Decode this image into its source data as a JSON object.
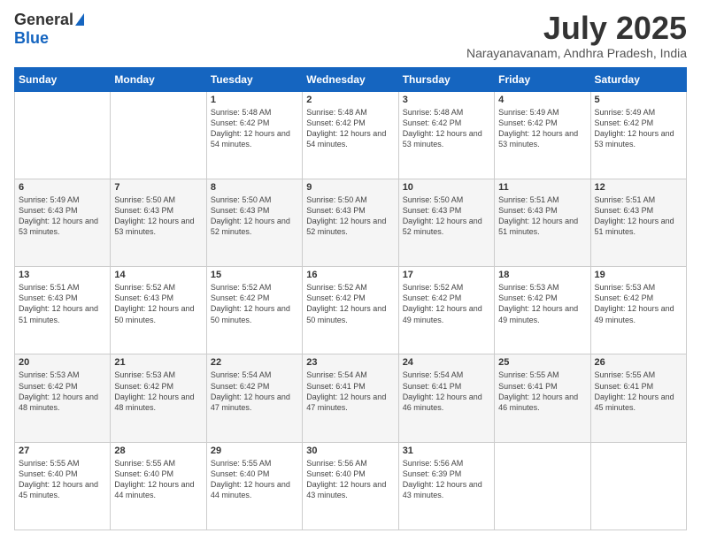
{
  "header": {
    "logo_general": "General",
    "logo_blue": "Blue",
    "title": "July 2025",
    "location": "Narayanavanam, Andhra Pradesh, India"
  },
  "days_of_week": [
    "Sunday",
    "Monday",
    "Tuesday",
    "Wednesday",
    "Thursday",
    "Friday",
    "Saturday"
  ],
  "weeks": [
    [
      {
        "day": "",
        "sunrise": "",
        "sunset": "",
        "daylight": ""
      },
      {
        "day": "",
        "sunrise": "",
        "sunset": "",
        "daylight": ""
      },
      {
        "day": "1",
        "sunrise": "Sunrise: 5:48 AM",
        "sunset": "Sunset: 6:42 PM",
        "daylight": "Daylight: 12 hours and 54 minutes."
      },
      {
        "day": "2",
        "sunrise": "Sunrise: 5:48 AM",
        "sunset": "Sunset: 6:42 PM",
        "daylight": "Daylight: 12 hours and 54 minutes."
      },
      {
        "day": "3",
        "sunrise": "Sunrise: 5:48 AM",
        "sunset": "Sunset: 6:42 PM",
        "daylight": "Daylight: 12 hours and 53 minutes."
      },
      {
        "day": "4",
        "sunrise": "Sunrise: 5:49 AM",
        "sunset": "Sunset: 6:42 PM",
        "daylight": "Daylight: 12 hours and 53 minutes."
      },
      {
        "day": "5",
        "sunrise": "Sunrise: 5:49 AM",
        "sunset": "Sunset: 6:42 PM",
        "daylight": "Daylight: 12 hours and 53 minutes."
      }
    ],
    [
      {
        "day": "6",
        "sunrise": "Sunrise: 5:49 AM",
        "sunset": "Sunset: 6:43 PM",
        "daylight": "Daylight: 12 hours and 53 minutes."
      },
      {
        "day": "7",
        "sunrise": "Sunrise: 5:50 AM",
        "sunset": "Sunset: 6:43 PM",
        "daylight": "Daylight: 12 hours and 53 minutes."
      },
      {
        "day": "8",
        "sunrise": "Sunrise: 5:50 AM",
        "sunset": "Sunset: 6:43 PM",
        "daylight": "Daylight: 12 hours and 52 minutes."
      },
      {
        "day": "9",
        "sunrise": "Sunrise: 5:50 AM",
        "sunset": "Sunset: 6:43 PM",
        "daylight": "Daylight: 12 hours and 52 minutes."
      },
      {
        "day": "10",
        "sunrise": "Sunrise: 5:50 AM",
        "sunset": "Sunset: 6:43 PM",
        "daylight": "Daylight: 12 hours and 52 minutes."
      },
      {
        "day": "11",
        "sunrise": "Sunrise: 5:51 AM",
        "sunset": "Sunset: 6:43 PM",
        "daylight": "Daylight: 12 hours and 51 minutes."
      },
      {
        "day": "12",
        "sunrise": "Sunrise: 5:51 AM",
        "sunset": "Sunset: 6:43 PM",
        "daylight": "Daylight: 12 hours and 51 minutes."
      }
    ],
    [
      {
        "day": "13",
        "sunrise": "Sunrise: 5:51 AM",
        "sunset": "Sunset: 6:43 PM",
        "daylight": "Daylight: 12 hours and 51 minutes."
      },
      {
        "day": "14",
        "sunrise": "Sunrise: 5:52 AM",
        "sunset": "Sunset: 6:43 PM",
        "daylight": "Daylight: 12 hours and 50 minutes."
      },
      {
        "day": "15",
        "sunrise": "Sunrise: 5:52 AM",
        "sunset": "Sunset: 6:42 PM",
        "daylight": "Daylight: 12 hours and 50 minutes."
      },
      {
        "day": "16",
        "sunrise": "Sunrise: 5:52 AM",
        "sunset": "Sunset: 6:42 PM",
        "daylight": "Daylight: 12 hours and 50 minutes."
      },
      {
        "day": "17",
        "sunrise": "Sunrise: 5:52 AM",
        "sunset": "Sunset: 6:42 PM",
        "daylight": "Daylight: 12 hours and 49 minutes."
      },
      {
        "day": "18",
        "sunrise": "Sunrise: 5:53 AM",
        "sunset": "Sunset: 6:42 PM",
        "daylight": "Daylight: 12 hours and 49 minutes."
      },
      {
        "day": "19",
        "sunrise": "Sunrise: 5:53 AM",
        "sunset": "Sunset: 6:42 PM",
        "daylight": "Daylight: 12 hours and 49 minutes."
      }
    ],
    [
      {
        "day": "20",
        "sunrise": "Sunrise: 5:53 AM",
        "sunset": "Sunset: 6:42 PM",
        "daylight": "Daylight: 12 hours and 48 minutes."
      },
      {
        "day": "21",
        "sunrise": "Sunrise: 5:53 AM",
        "sunset": "Sunset: 6:42 PM",
        "daylight": "Daylight: 12 hours and 48 minutes."
      },
      {
        "day": "22",
        "sunrise": "Sunrise: 5:54 AM",
        "sunset": "Sunset: 6:42 PM",
        "daylight": "Daylight: 12 hours and 47 minutes."
      },
      {
        "day": "23",
        "sunrise": "Sunrise: 5:54 AM",
        "sunset": "Sunset: 6:41 PM",
        "daylight": "Daylight: 12 hours and 47 minutes."
      },
      {
        "day": "24",
        "sunrise": "Sunrise: 5:54 AM",
        "sunset": "Sunset: 6:41 PM",
        "daylight": "Daylight: 12 hours and 46 minutes."
      },
      {
        "day": "25",
        "sunrise": "Sunrise: 5:55 AM",
        "sunset": "Sunset: 6:41 PM",
        "daylight": "Daylight: 12 hours and 46 minutes."
      },
      {
        "day": "26",
        "sunrise": "Sunrise: 5:55 AM",
        "sunset": "Sunset: 6:41 PM",
        "daylight": "Daylight: 12 hours and 45 minutes."
      }
    ],
    [
      {
        "day": "27",
        "sunrise": "Sunrise: 5:55 AM",
        "sunset": "Sunset: 6:40 PM",
        "daylight": "Daylight: 12 hours and 45 minutes."
      },
      {
        "day": "28",
        "sunrise": "Sunrise: 5:55 AM",
        "sunset": "Sunset: 6:40 PM",
        "daylight": "Daylight: 12 hours and 44 minutes."
      },
      {
        "day": "29",
        "sunrise": "Sunrise: 5:55 AM",
        "sunset": "Sunset: 6:40 PM",
        "daylight": "Daylight: 12 hours and 44 minutes."
      },
      {
        "day": "30",
        "sunrise": "Sunrise: 5:56 AM",
        "sunset": "Sunset: 6:40 PM",
        "daylight": "Daylight: 12 hours and 43 minutes."
      },
      {
        "day": "31",
        "sunrise": "Sunrise: 5:56 AM",
        "sunset": "Sunset: 6:39 PM",
        "daylight": "Daylight: 12 hours and 43 minutes."
      },
      {
        "day": "",
        "sunrise": "",
        "sunset": "",
        "daylight": ""
      },
      {
        "day": "",
        "sunrise": "",
        "sunset": "",
        "daylight": ""
      }
    ]
  ]
}
